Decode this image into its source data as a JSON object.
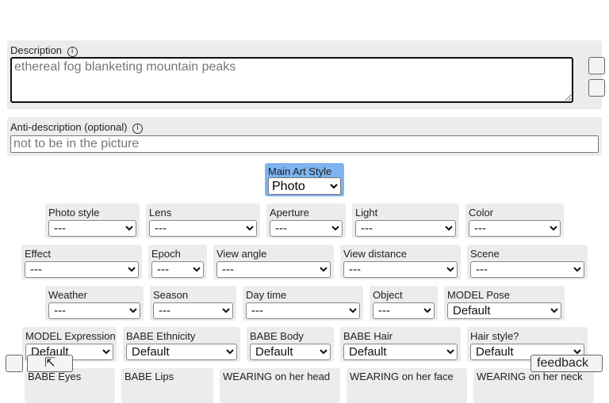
{
  "header": {
    "icon": ""
  },
  "description": {
    "label": "Description",
    "placeholder": "ethereal fog blanketing mountain peaks",
    "btn1": "",
    "btn2": ""
  },
  "anti_description": {
    "label": "Anti-description (optional)",
    "placeholder": "not to be in the picture"
  },
  "glyph": "",
  "info": "i",
  "main_art_style": {
    "label": "Main Art Style",
    "value": "Photo"
  },
  "row1": [
    {
      "label": "Photo style",
      "value": "---"
    },
    {
      "label": "Lens",
      "value": "---"
    },
    {
      "label": "Aperture",
      "value": "---"
    },
    {
      "label": "Light",
      "value": "---"
    },
    {
      "label": "Color",
      "value": "---"
    }
  ],
  "row2": [
    {
      "label": "Effect",
      "value": "---"
    },
    {
      "label": "Epoch",
      "value": "---"
    },
    {
      "label": "View angle",
      "value": "---"
    },
    {
      "label": "View distance",
      "value": "---"
    },
    {
      "label": "Scene",
      "value": "---"
    }
  ],
  "row3": [
    {
      "label": "Weather",
      "value": "---"
    },
    {
      "label": "Season",
      "value": "---"
    },
    {
      "label": "Day time",
      "value": "---"
    },
    {
      "label": "Object",
      "value": "---"
    },
    {
      "label": "MODEL Pose",
      "value": "Default"
    }
  ],
  "row4": [
    {
      "label": "MODEL Expression",
      "value": "Default"
    },
    {
      "label": "BABE Ethnicity",
      "value": "Default"
    },
    {
      "label": "BABE Body",
      "value": "Default"
    },
    {
      "label": "BABE Hair",
      "value": "Default"
    },
    {
      "label": "Hair style?",
      "value": "Default"
    }
  ],
  "row5": [
    {
      "label": "BABE Eyes"
    },
    {
      "label": "BABE Lips"
    },
    {
      "label": "WEARING on her head"
    },
    {
      "label": "WEARING on her face"
    },
    {
      "label": "WEARING on her neck"
    }
  ],
  "bottom": {
    "left_icon": "",
    "arrow_icon": "⇱",
    "feedback_icon": "",
    "feedback": "feedback"
  }
}
